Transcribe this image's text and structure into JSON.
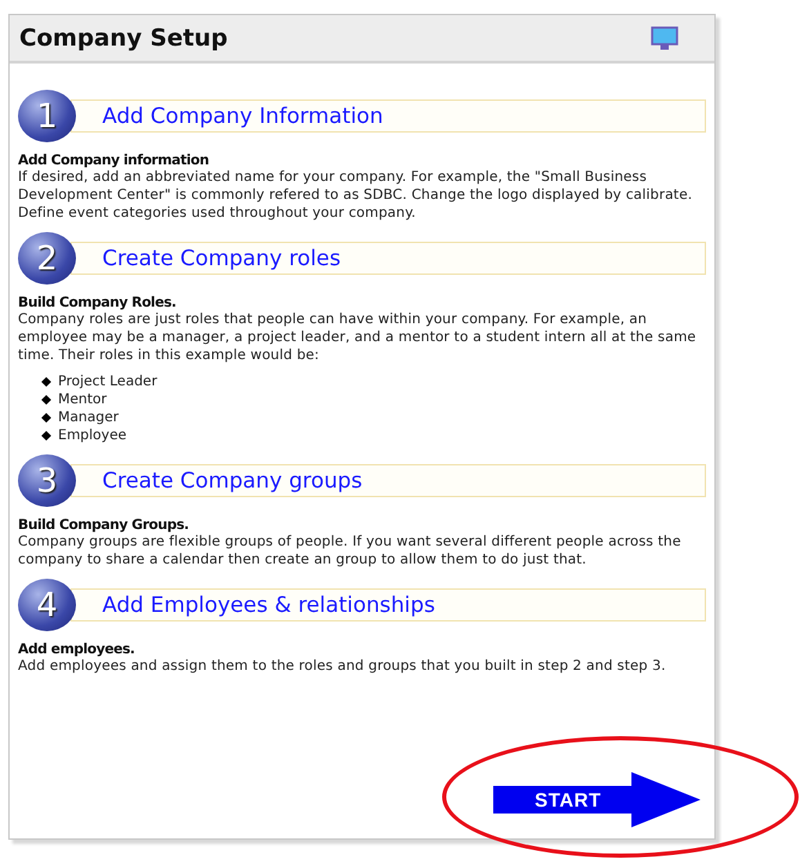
{
  "panel": {
    "title": "Company Setup"
  },
  "steps": [
    {
      "number": "1",
      "heading": "Add Company Information",
      "subtitle": "Add Company information",
      "text": "If desired, add an abbreviated name for your company. For example, the \"Small Business Development Center\" is commonly refered to as SDBC. Change the logo displayed by calibrate. Define event categories used throughout your company."
    },
    {
      "number": "2",
      "heading": "Create Company roles",
      "subtitle": "Build Company Roles.",
      "text": "Company roles are just roles that people can have within your company. For example, an employee may be a manager, a project leader, and a mentor to a student intern all at the same time. Their roles in this example would be:",
      "bullets": [
        "Project Leader",
        "Mentor",
        "Manager",
        "Employee"
      ]
    },
    {
      "number": "3",
      "heading": "Create Company groups",
      "subtitle": "Build Company Groups.",
      "text": "Company groups are flexible groups of people. If you want several different people across the company to share a calendar then create an group to allow them to do just that."
    },
    {
      "number": "4",
      "heading": "Add Employees & relationships",
      "subtitle": "Add employees.",
      "text": "Add employees and assign them to the roles and groups that you built in step 2 and step 3."
    }
  ],
  "start_button": {
    "label": "START"
  }
}
